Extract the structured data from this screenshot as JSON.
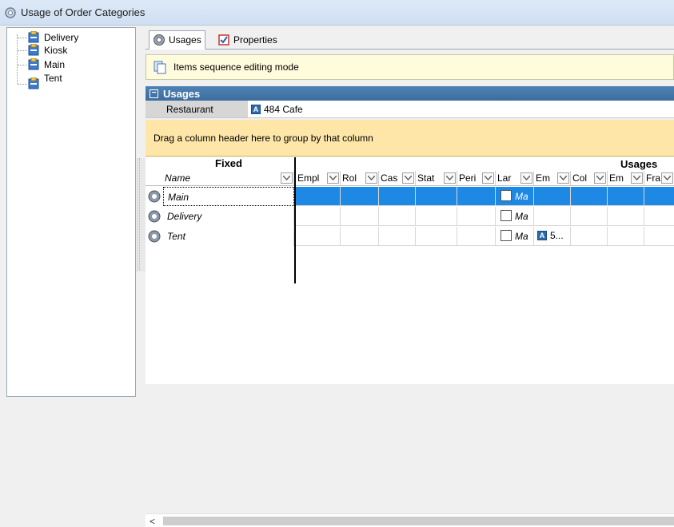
{
  "window": {
    "title": "Usage of Order Categories"
  },
  "tree": {
    "items": [
      {
        "label": "Delivery"
      },
      {
        "label": "Kiosk"
      },
      {
        "label": "Main"
      },
      {
        "label": "Tent"
      }
    ]
  },
  "tabs": [
    {
      "label": "Usages",
      "icon": "gear-icon",
      "active": true
    },
    {
      "label": "Properties",
      "icon": "checklist-icon",
      "active": false
    }
  ],
  "info_bar": {
    "text": "Items sequence editing mode"
  },
  "usages_section": {
    "title": "Usages",
    "restaurant_label": "Restaurant",
    "restaurant_badge": "A",
    "restaurant_value": "484 Cafe"
  },
  "group_panel": {
    "text": "Drag a column header here to group by that column"
  },
  "grid": {
    "band_fixed": "Fixed",
    "band_usages": "Usages",
    "name_column": "Name",
    "columns": [
      "Empl",
      "Rol",
      "Cas",
      "Stat",
      "Peri",
      "Lar",
      "Em",
      "Col",
      "Em",
      "Fra"
    ],
    "rows": [
      {
        "name": "Main",
        "ma": "Ma",
        "em": ""
      },
      {
        "name": "Delivery",
        "ma": "Ma",
        "em": ""
      },
      {
        "name": "Tent",
        "ma": "Ma",
        "em_badge": "A",
        "em": "5..."
      }
    ],
    "selected_row": "Main"
  },
  "colors": {
    "selection": "#1e88e5",
    "header_band": "#4f82b4",
    "group_panel": "#fde6a7",
    "info_bar": "#fffbdc"
  }
}
